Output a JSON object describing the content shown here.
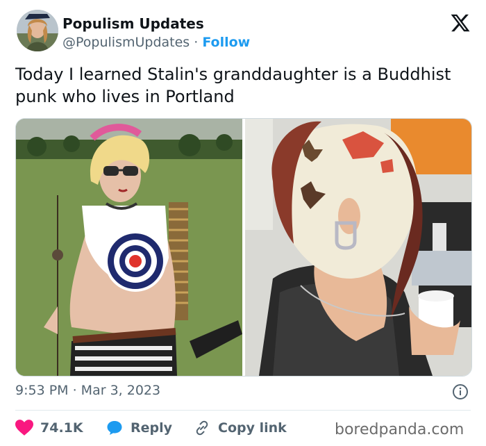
{
  "account": {
    "name": "Populism Updates",
    "handle": "@PopulismUpdates",
    "separator": "·",
    "follow_label": "Follow",
    "brand_icon": "x-logo-icon"
  },
  "tweet": {
    "text": "Today I learned Stalin's granddaughter is a Buddhist punk who lives in Portland",
    "timestamp": "9:53 PM · Mar 3, 2023"
  },
  "actions": {
    "like_count": "74.1K",
    "reply_label": "Reply",
    "copy_label": "Copy link"
  },
  "watermark": "boredpanda.com",
  "colors": {
    "accent": "#1d9bf0",
    "like": "#f91880",
    "text": "#0f1419",
    "secondary": "#536471"
  }
}
